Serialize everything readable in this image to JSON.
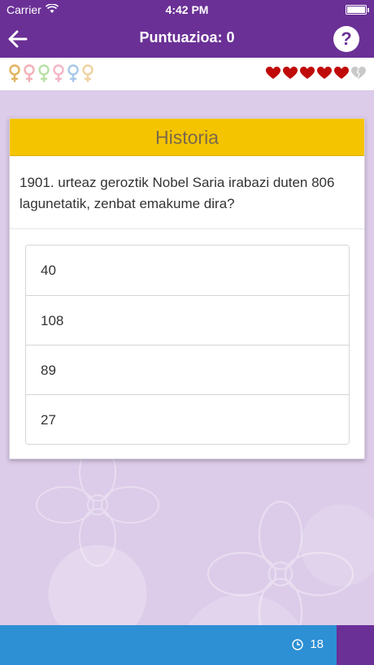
{
  "status_bar": {
    "carrier": "Carrier",
    "time": "4:42 PM"
  },
  "header": {
    "title": "Puntuazioa: 0",
    "help_label": "?"
  },
  "progress": {
    "female_symbol_colors": [
      "#e3b35f",
      "#f2b0b8",
      "#b9dfa6",
      "#f4b6c6",
      "#a8c8e8",
      "#f0d2a0"
    ],
    "hearts_total": 6,
    "hearts_full": 5,
    "heart_color": "#c00a0a",
    "heart_broken_color": "#c9c9c9"
  },
  "card": {
    "category": "Historia",
    "question": "1901. urteaz geroztik Nobel Saria irabazi duten 806 lagunetatik, zenbat emakume dira?",
    "answers": [
      "40",
      "108",
      "89",
      "27"
    ]
  },
  "footer": {
    "timer_value": "18"
  },
  "colors": {
    "primary": "#6a3096",
    "accent_yellow": "#f5c400",
    "footer_blue": "#2d8fd4"
  }
}
